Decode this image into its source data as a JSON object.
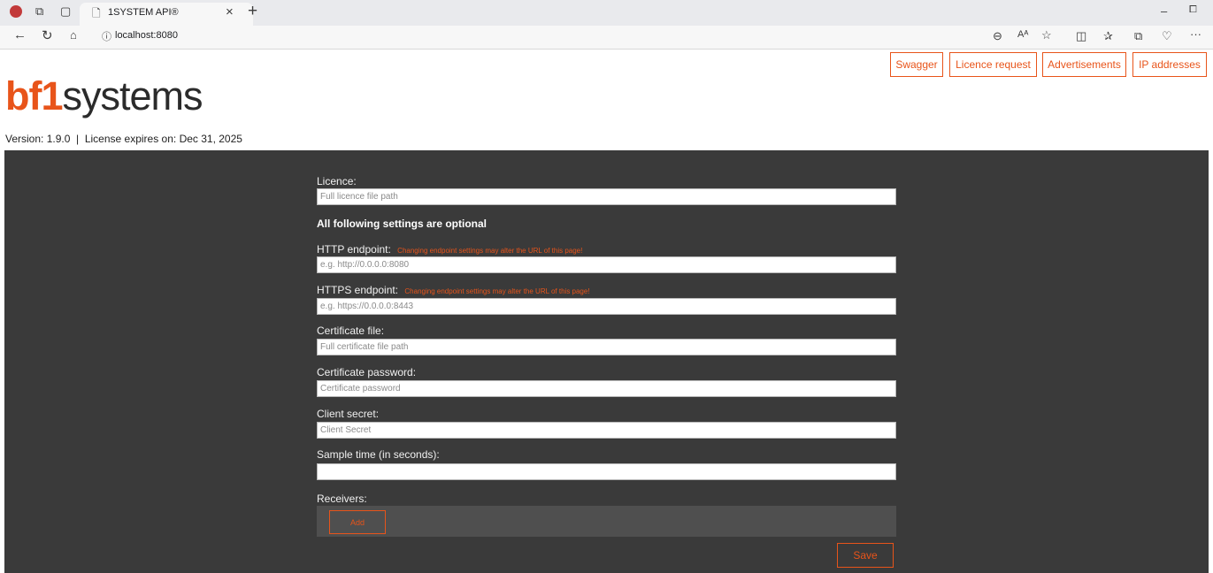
{
  "browser": {
    "tab_title": "1SYSTEM API®",
    "url": "localhost:8080"
  },
  "header": {
    "logo_part1": "bf",
    "logo_part2": "1",
    "logo_part3": "systems",
    "version_line": "Version: 1.9.0  |  License expires on: Dec 31, 2025",
    "nav": [
      {
        "label": "Swagger"
      },
      {
        "label": "Licence request"
      },
      {
        "label": "Advertisements"
      },
      {
        "label": "IP addresses"
      }
    ]
  },
  "form": {
    "licence_label": "Licence:",
    "licence_placeholder": "Full licence file path",
    "optional_heading": "All following settings are optional",
    "http_label": "HTTP endpoint:",
    "http_warning": "Changing endpoint settings may alter the URL of this page!",
    "http_placeholder": "e.g. http://0.0.0.0:8080",
    "https_label": "HTTPS endpoint:",
    "https_warning": "Changing endpoint settings may alter the URL of this page!",
    "https_placeholder": "e.g. https://0.0.0.0:8443",
    "cert_file_label": "Certificate file:",
    "cert_file_placeholder": "Full certificate file path",
    "cert_password_label": "Certificate password:",
    "cert_password_placeholder": "Certificate password",
    "client_secret_label": "Client secret:",
    "client_secret_placeholder": "Client Secret",
    "sample_time_label": "Sample time (in seconds):",
    "sample_time_value": "",
    "receivers_label": "Receivers:",
    "add_label": "Add",
    "save_label": "Save"
  },
  "colors": {
    "accent": "#e8541a",
    "panel": "#3a3a3a"
  }
}
